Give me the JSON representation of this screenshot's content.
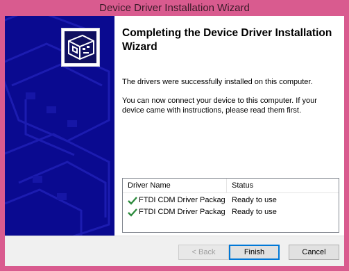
{
  "window": {
    "title": "Device Driver Installation Wizard"
  },
  "wizard": {
    "heading": "Completing the Device Driver Installation Wizard",
    "success_text": "The drivers were successfully installed on this computer.",
    "instructions_text": "You can now connect your device to this computer. If your device came with instructions, please read them first."
  },
  "driver_list": {
    "columns": [
      "Driver Name",
      "Status"
    ],
    "rows": [
      {
        "name": "FTDI CDM Driver Package",
        "status": "Ready to use",
        "icon": "checkmark-icon"
      },
      {
        "name": "FTDI CDM Driver Package",
        "status": "Ready to use",
        "icon": "checkmark-icon"
      }
    ]
  },
  "buttons": {
    "back": "< Back",
    "finish": "Finish",
    "cancel": "Cancel"
  },
  "colors": {
    "title_bar": "#d95b8f",
    "sidebar": "#0a0a90",
    "checkmark": "#2e8b3e",
    "default_button_border": "#0078d7"
  }
}
